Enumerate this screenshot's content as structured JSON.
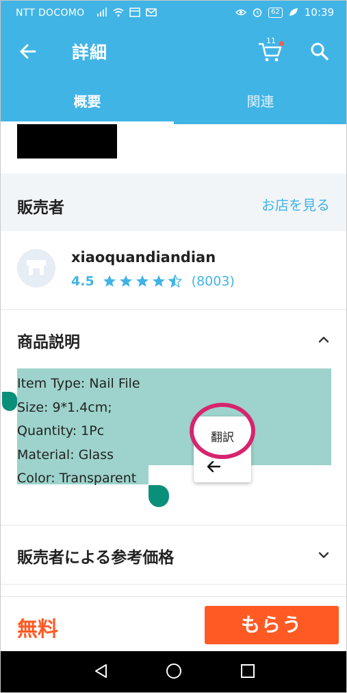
{
  "status_bar": {
    "carrier": "NTT DOCOMO",
    "battery": "62",
    "time": "10:39"
  },
  "app_bar": {
    "title": "詳細",
    "cart_count": "11"
  },
  "tabs": [
    {
      "label": "概要",
      "active": true
    },
    {
      "label": "関連",
      "active": false
    }
  ],
  "seller": {
    "section_title": "販売者",
    "shop_link": "お店を見る",
    "shop_name": "xiaoquandiandian",
    "rating": "4.5",
    "stars": 4.5,
    "review_count": "(8003)"
  },
  "description": {
    "section_title": "商品説明",
    "lines": [
      "Item Type: Nail File",
      "Size: 9*1.4cm;",
      "Quantity: 1Pc",
      "Material: Glass",
      "Color: Transparent"
    ]
  },
  "popup": {
    "translate_label": "翻訳"
  },
  "reference_price": {
    "section_title": "販売者による参考価格"
  },
  "bottom": {
    "price_label": "無料",
    "action_label": "もらう"
  },
  "colors": {
    "brand_blue": "#41b4e6",
    "action_orange": "#ff5a24",
    "selection": "#9dd3cc",
    "handle": "#0a8f7a",
    "highlight_ring": "#d6246e"
  }
}
